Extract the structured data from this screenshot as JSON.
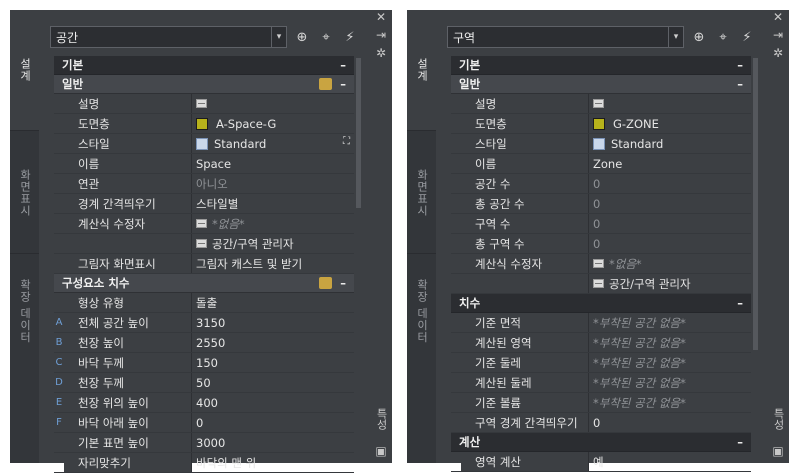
{
  "palettes": [
    {
      "combo_value": "공간",
      "tabs": [
        "설계",
        "화면표시",
        "확장 데이터"
      ],
      "right_tab": "특성",
      "sections": [
        {
          "title": "기본",
          "type": "dark",
          "collapse": "–"
        },
        {
          "title": "일반",
          "type": "mid",
          "collapse": "–",
          "has_icon": true,
          "rows": [
            {
              "label": "설명",
              "value": "",
              "icon": "table"
            },
            {
              "label": "도면층",
              "value": "A-Space-G",
              "icon": "layer"
            },
            {
              "label": "스타일",
              "value": "Standard",
              "icon": "style",
              "binocular": true
            },
            {
              "label": "이름",
              "value": "Space"
            },
            {
              "label": "연관",
              "value": "아니오",
              "dim": true
            },
            {
              "label": "경계 간격띄우기",
              "value": "스타일별"
            },
            {
              "label": "계산식 수정자",
              "value": "*없음*",
              "icon": "table",
              "dim": true,
              "italic": true
            },
            {
              "label": "",
              "value": "공간/구역 관리자",
              "icon": "table"
            },
            {
              "label": "그림자 화면표시",
              "value": "그림자 캐스트 및 받기"
            }
          ]
        },
        {
          "title": "구성요소 치수",
          "type": "mid",
          "collapse": "–",
          "has_icon": true,
          "rows": [
            {
              "label": "형상 유형",
              "value": "돌출"
            },
            {
              "letter": "A",
              "label": "전체 공간 높이",
              "value": "3150"
            },
            {
              "letter": "B",
              "label": "천장 높이",
              "value": "2550"
            },
            {
              "letter": "C",
              "label": "바닥 두께",
              "value": "150"
            },
            {
              "letter": "D",
              "label": "천장 두께",
              "value": "50"
            },
            {
              "letter": "E",
              "label": "천장 위의 높이",
              "value": "400"
            },
            {
              "letter": "F",
              "label": "바닥 아래 높이",
              "value": "0"
            },
            {
              "label": "기본 표면 높이",
              "value": "3000"
            },
            {
              "label": "자리맞추기",
              "value": "바닥의 맨 위"
            }
          ]
        }
      ]
    },
    {
      "combo_value": "구역",
      "tabs": [
        "설계",
        "화면표시",
        "확장 데이터"
      ],
      "right_tab": "특성",
      "sections": [
        {
          "title": "기본",
          "type": "dark",
          "collapse": "–"
        },
        {
          "title": "일반",
          "type": "mid",
          "collapse": "–",
          "rows": [
            {
              "label": "설명",
              "value": "",
              "icon": "table"
            },
            {
              "label": "도면층",
              "value": "G-ZONE",
              "icon": "layer"
            },
            {
              "label": "스타일",
              "value": "Standard",
              "icon": "style"
            },
            {
              "label": "이름",
              "value": "Zone"
            },
            {
              "label": "공간 수",
              "value": "0",
              "dim": true
            },
            {
              "label": "총 공간 수",
              "value": "0",
              "dim": true
            },
            {
              "label": "구역 수",
              "value": "0",
              "dim": true
            },
            {
              "label": "총 구역 수",
              "value": "0",
              "dim": true
            },
            {
              "label": "계산식 수정자",
              "value": "*없음*",
              "icon": "table",
              "dim": true,
              "italic": true
            },
            {
              "label": "",
              "value": "공간/구역 관리자",
              "icon": "table"
            }
          ]
        },
        {
          "title": "치수",
          "type": "dark",
          "collapse": "–",
          "rows": [
            {
              "label": "기준 면적",
              "value": "*부착된 공간 없음*",
              "dim": true,
              "italic": true
            },
            {
              "label": "계산된 영역",
              "value": "*부착된 공간 없음*",
              "dim": true,
              "italic": true
            },
            {
              "label": "기준 둘레",
              "value": "*부착된 공간 없음*",
              "dim": true,
              "italic": true
            },
            {
              "label": "계산된 둘레",
              "value": "*부착된 공간 없음*",
              "dim": true,
              "italic": true
            },
            {
              "label": "기준 볼륨",
              "value": "*부착된 공간 없음*",
              "dim": true,
              "italic": true
            },
            {
              "label": "구역 경계 간격띄우기",
              "value": "0"
            }
          ]
        },
        {
          "title": "계산",
          "type": "dark",
          "collapse": "–",
          "rows": [
            {
              "label": "영역 계산",
              "value": "예"
            }
          ]
        }
      ]
    }
  ]
}
